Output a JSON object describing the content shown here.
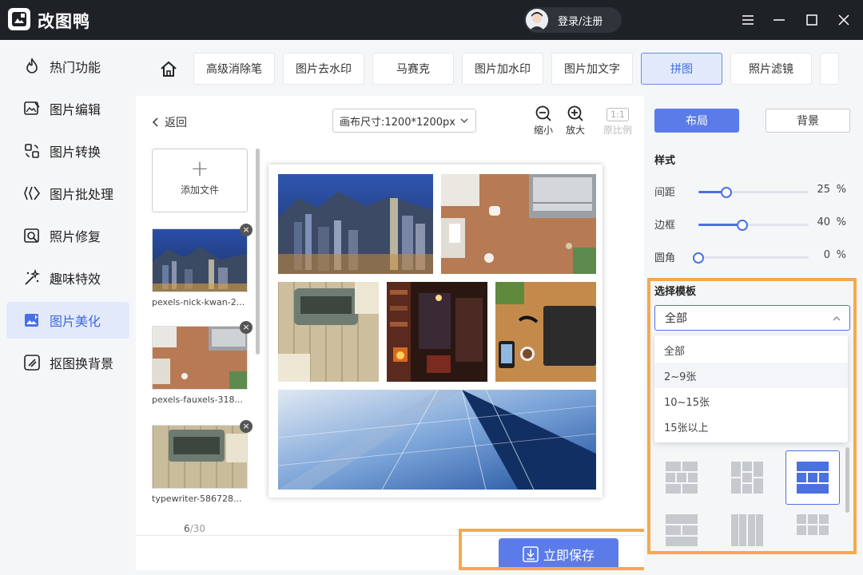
{
  "app": {
    "title": "改图鸭",
    "login_label": "登录/注册"
  },
  "sidebar": {
    "items": [
      {
        "label": "热门功能",
        "icon": "flame-icon"
      },
      {
        "label": "图片编辑",
        "icon": "image-edit-icon"
      },
      {
        "label": "图片转换",
        "icon": "convert-icon"
      },
      {
        "label": "图片批处理",
        "icon": "batch-icon"
      },
      {
        "label": "照片修复",
        "icon": "photo-repair-icon"
      },
      {
        "label": "趣味特效",
        "icon": "magic-wand-icon"
      },
      {
        "label": "图片美化",
        "icon": "beautify-icon",
        "active": true
      },
      {
        "label": "抠图换背景",
        "icon": "cutout-icon"
      }
    ]
  },
  "tabs": [
    {
      "label": "高级消除笔"
    },
    {
      "label": "图片去水印"
    },
    {
      "label": "马赛克"
    },
    {
      "label": "图片加水印"
    },
    {
      "label": "图片加文字"
    },
    {
      "label": "拼图",
      "active": true
    },
    {
      "label": "照片滤镜"
    }
  ],
  "toolbar": {
    "back_label": "返回",
    "canvas_size": "画布尺寸:1200*1200px",
    "zoom_out_label": "缩小",
    "zoom_in_label": "放大",
    "ratio_label": "原比例",
    "ratio_value": "1:1"
  },
  "files": {
    "add_label": "添加文件",
    "items": [
      {
        "name": "pexels-nick-kwan-2..."
      },
      {
        "name": "pexels-fauxels-318..."
      },
      {
        "name": "typewriter-586728..."
      }
    ],
    "count": "6",
    "total": "/30"
  },
  "save_label": "立即保存",
  "right_panel": {
    "tab_layout": "布局",
    "tab_background": "背景",
    "style_title": "样式",
    "sliders": [
      {
        "label": "间距",
        "value": "25",
        "unit": "%",
        "fraction": 0.25
      },
      {
        "label": "边框",
        "value": "40",
        "unit": "%",
        "fraction": 0.4
      },
      {
        "label": "圆角",
        "value": "0",
        "unit": "%",
        "fraction": 0.0
      }
    ],
    "template_title": "选择模板",
    "template_selected": "全部",
    "template_options": [
      "全部",
      "2~9张",
      "10~15张",
      "15张以上"
    ]
  },
  "colors": {
    "accent": "#4a71e2",
    "highlight": "#f5a94b",
    "titlebar": "#1e2227"
  }
}
